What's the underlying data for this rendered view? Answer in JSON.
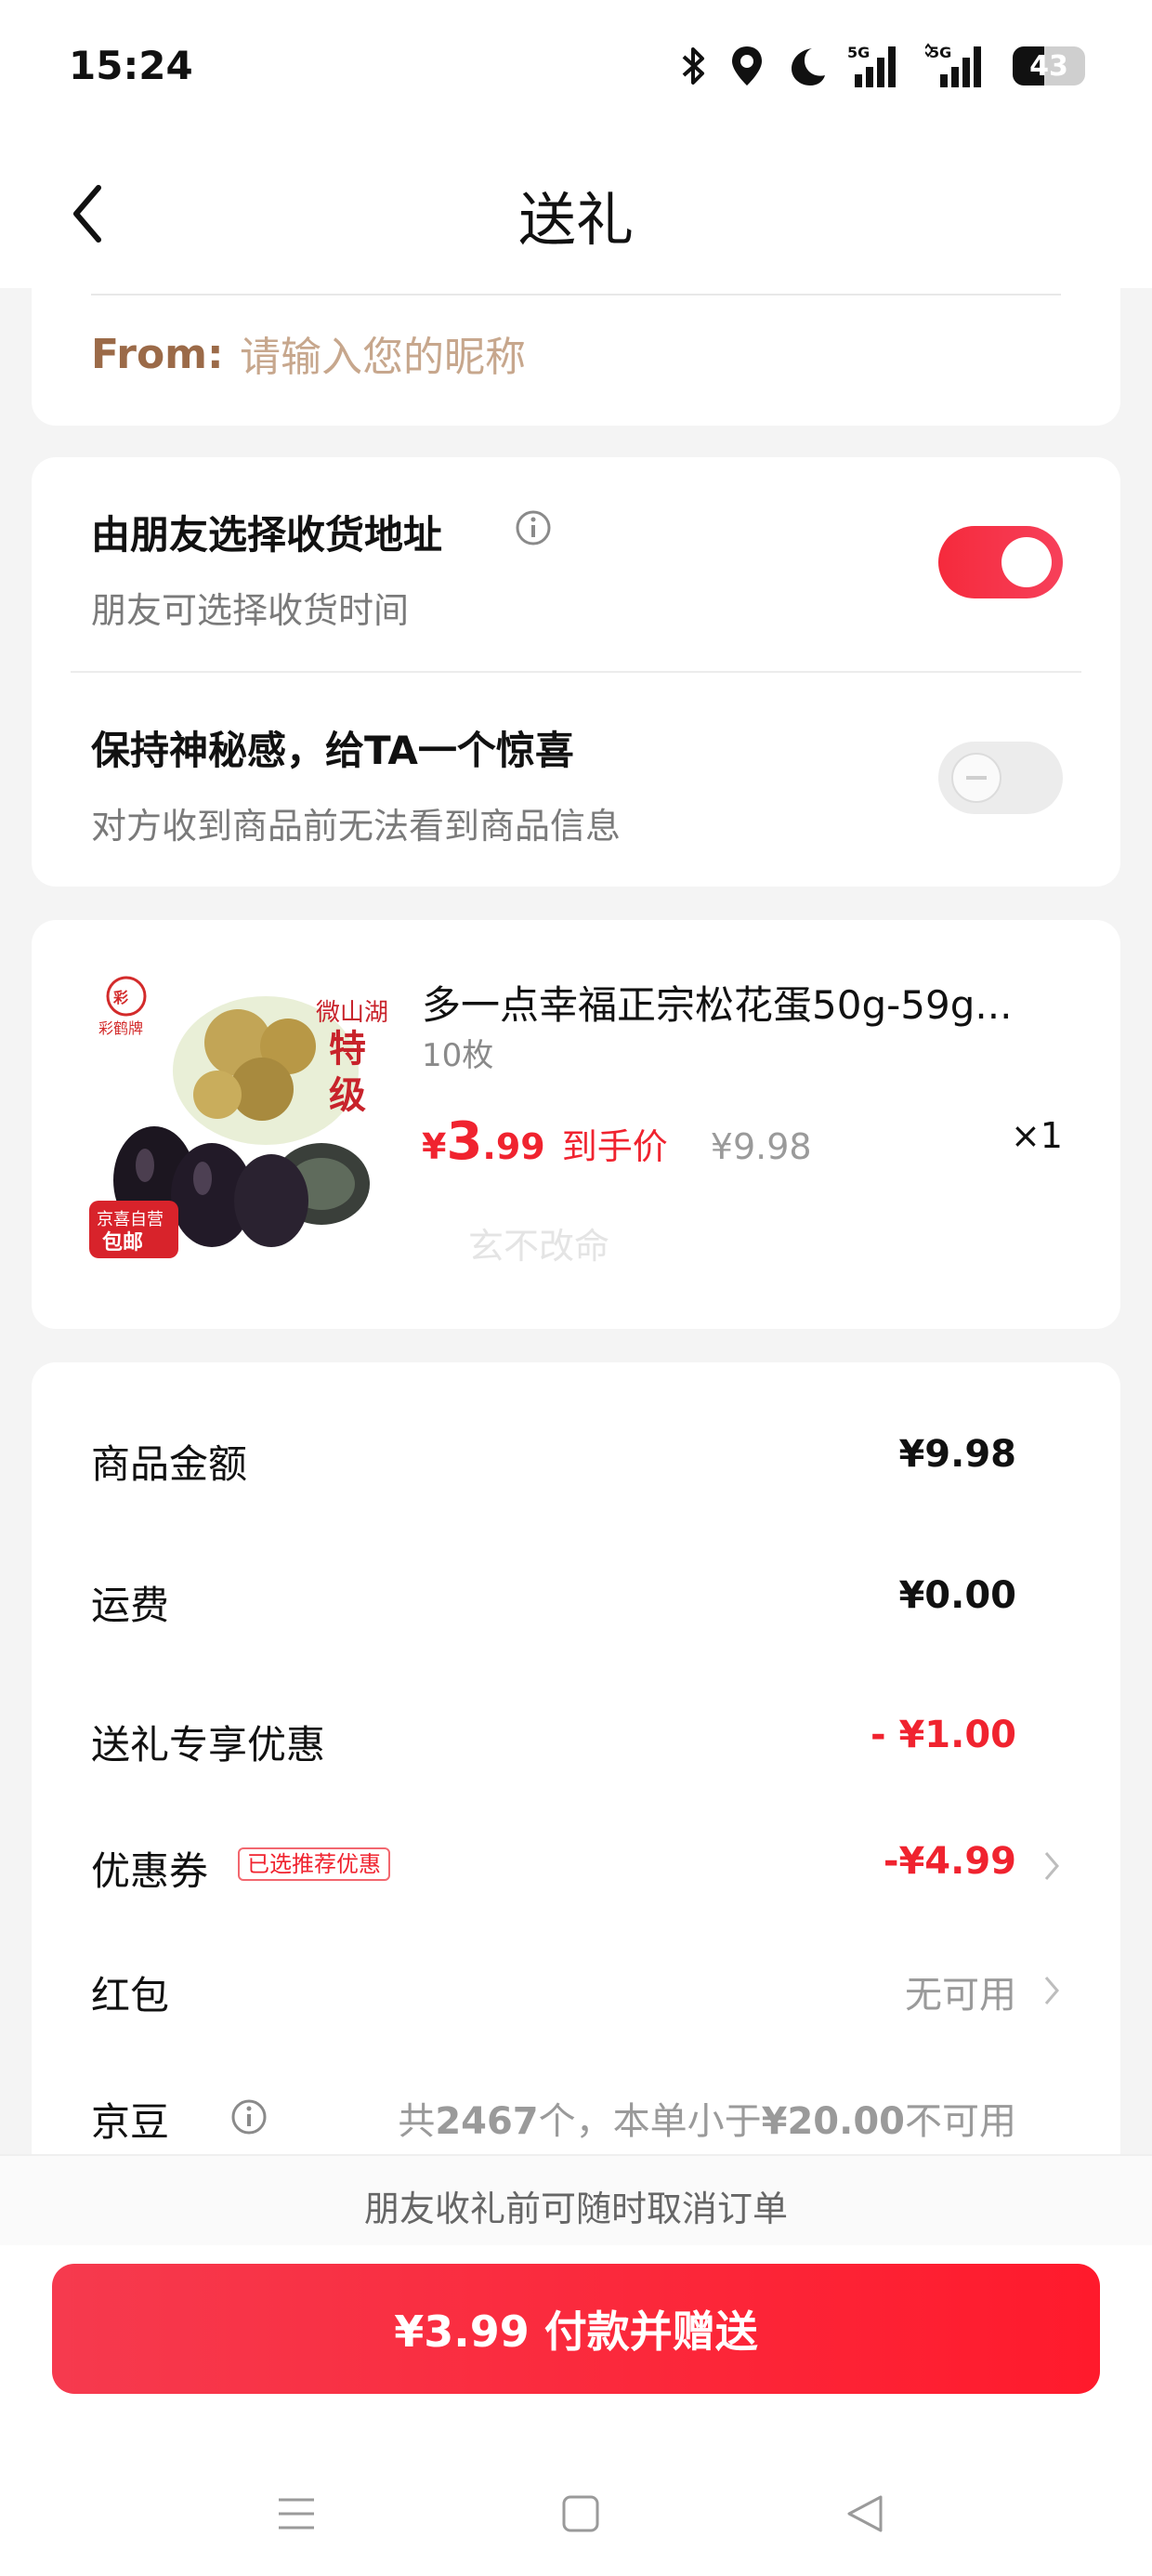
{
  "status_bar": {
    "time": "15:24",
    "battery_level": "43",
    "network_1": "5G",
    "network_2": "5G"
  },
  "header": {
    "title": "送礼"
  },
  "from_field": {
    "label": "From:",
    "placeholder": "请输入您的昵称",
    "value": ""
  },
  "options": {
    "friend_address": {
      "title": "由朋友选择收货地址",
      "subtitle": "朋友可选择收货时间",
      "enabled": true
    },
    "mystery": {
      "title": "保持神秘感，给TA一个惊喜",
      "subtitle": "对方收到商品前无法看到商品信息",
      "enabled": false
    }
  },
  "product": {
    "title": "多一点幸福正宗松花蛋50g-59g...",
    "spec": "10枚",
    "price_symbol": "¥",
    "price_int": "3",
    "price_dec": ".99",
    "price_tag": "到手价",
    "original_price": "¥9.98",
    "quantity": "×1",
    "watermark": "玄不改命",
    "image_texts": {
      "brand": "彩鹤牌",
      "origin": "微山湖",
      "grade_1": "特",
      "grade_2": "级",
      "badge_top": "京喜自营",
      "badge_bottom": "包邮"
    }
  },
  "summary": {
    "goods_amount": {
      "label": "商品金额",
      "value": "¥9.98"
    },
    "shipping": {
      "label": "运费",
      "value": "¥0.00"
    },
    "gift_discount": {
      "label": "送礼专享优惠",
      "value": "- ¥1.00"
    },
    "coupon": {
      "label": "优惠券",
      "badge": "已选推荐优惠",
      "value": "-¥4.99"
    },
    "red_packet": {
      "label": "红包",
      "value": "无可用"
    },
    "beans": {
      "label": "京豆",
      "note_prefix": "共",
      "note_count": "2467",
      "note_mid": "个，本单小于",
      "note_amount": "¥20.00",
      "note_suffix": "不可用"
    }
  },
  "footer": {
    "cancel_note": "朋友收礼前可随时取消订单",
    "pay_button": "¥3.99 付款并赠送"
  },
  "colors": {
    "accent_red": "#f0232f",
    "from_label": "#9b6a48",
    "from_placeholder": "#c7a78d"
  }
}
